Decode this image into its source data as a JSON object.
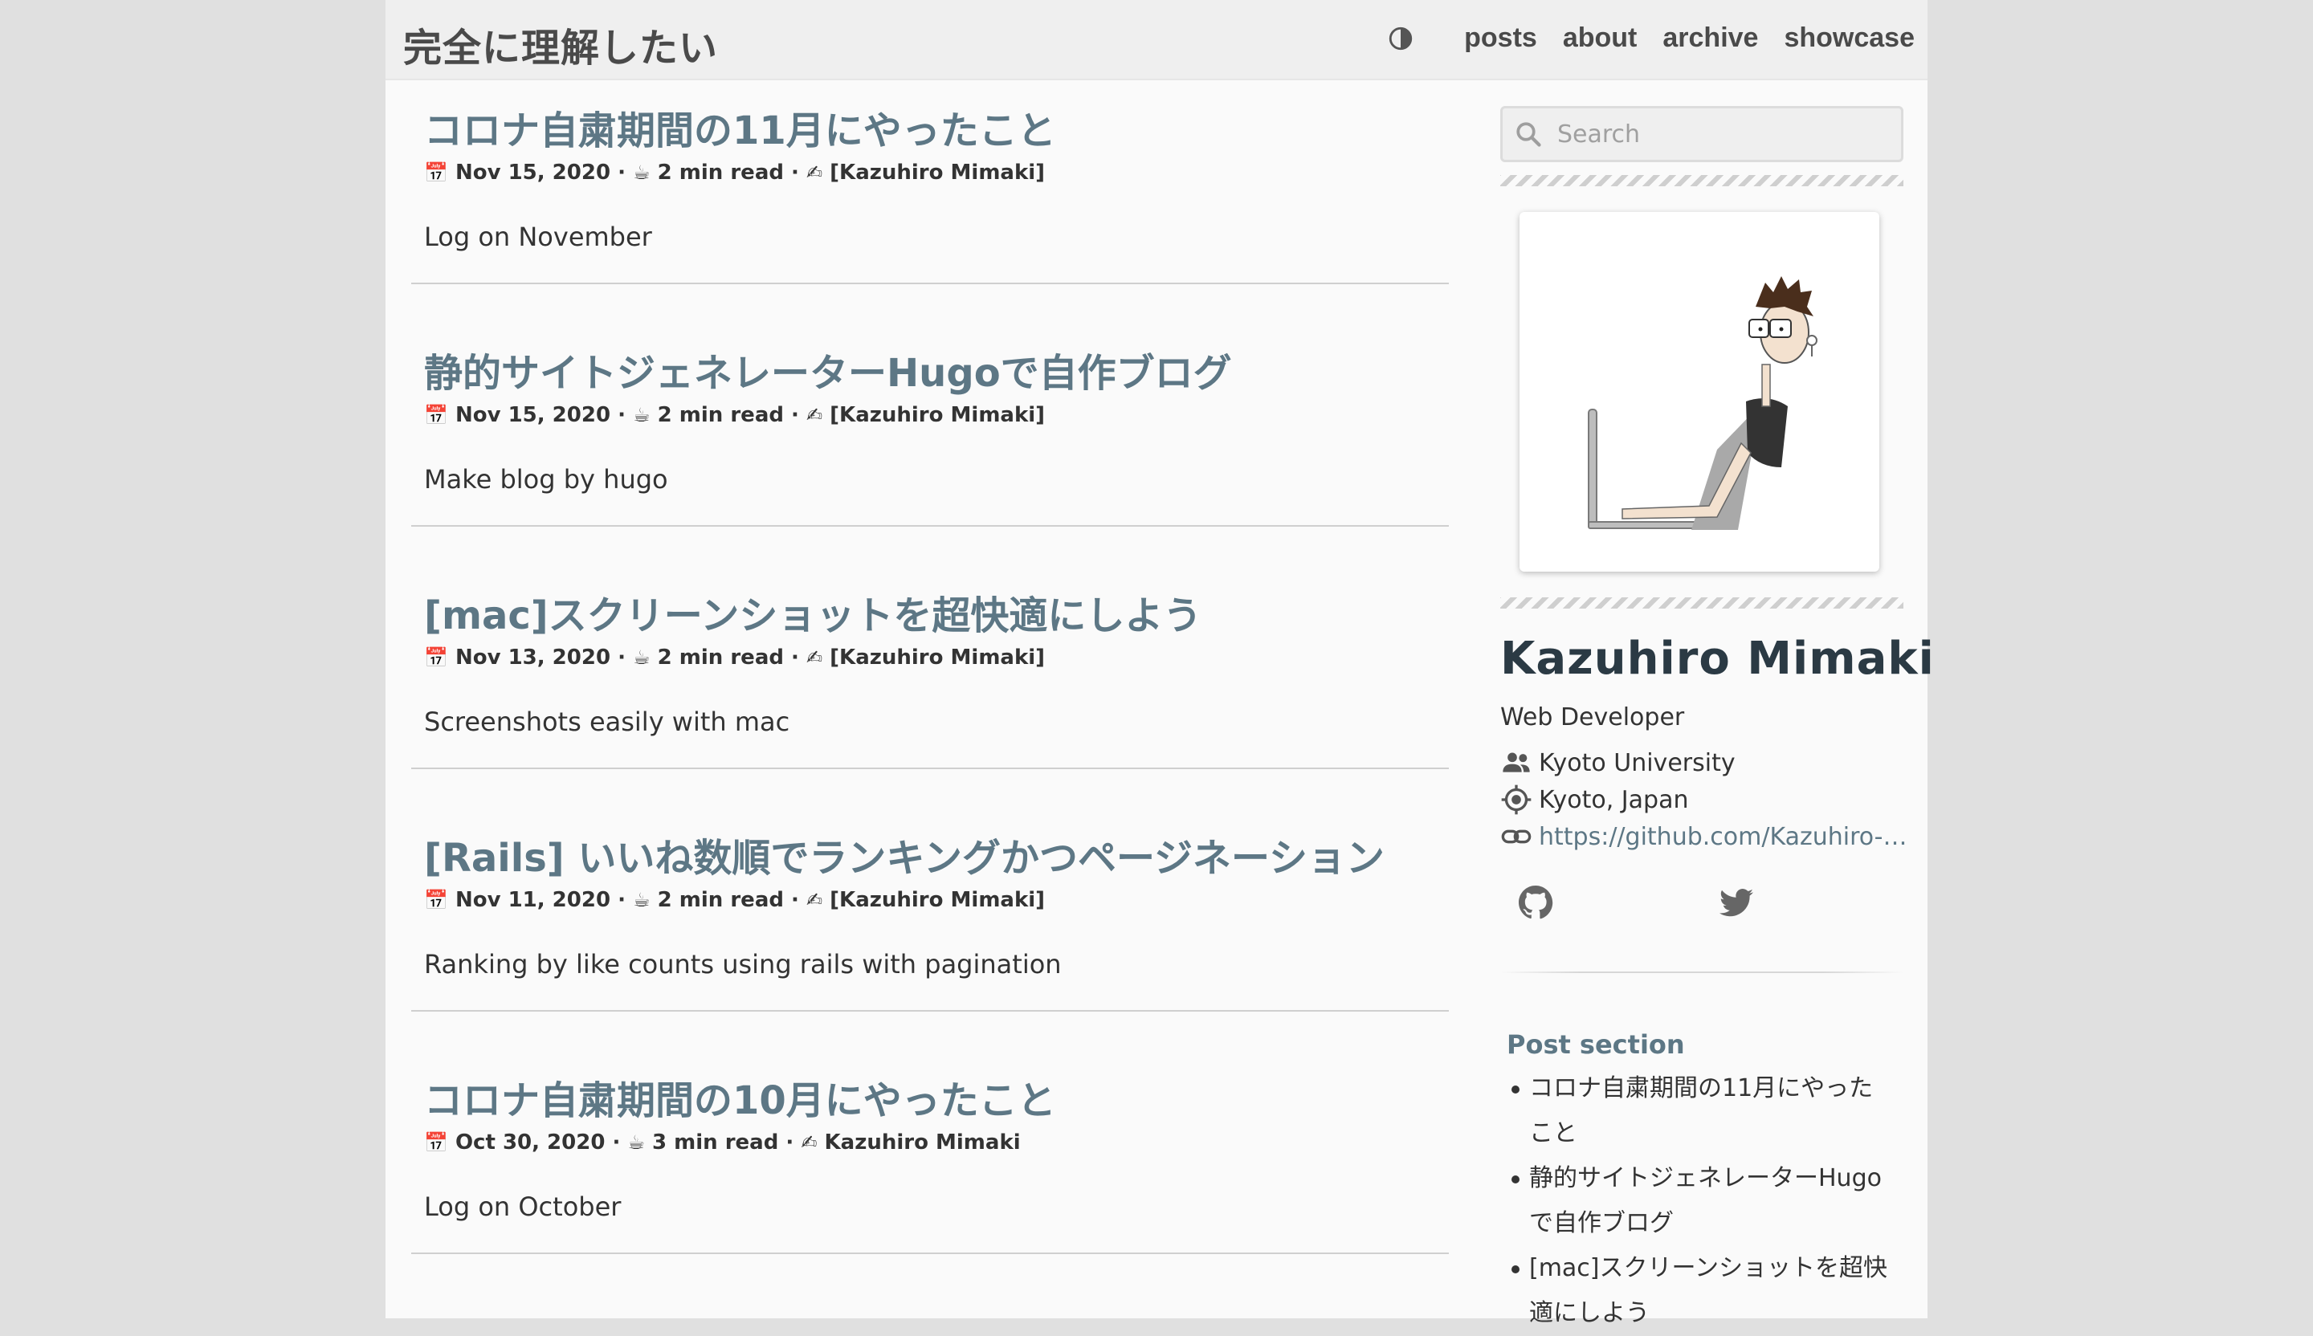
{
  "site": {
    "title": "完全に理解したい"
  },
  "nav": {
    "items": [
      "posts",
      "about",
      "archive",
      "showcase"
    ]
  },
  "posts": [
    {
      "title": "コロナ自粛期間の11月にやったこと",
      "date": "Nov 15, 2020",
      "read": "2 min read",
      "author": "[Kazuhiro Mimaki]",
      "summary": "Log on November"
    },
    {
      "title": "静的サイトジェネレーターHugoで自作ブログ",
      "date": "Nov 15, 2020",
      "read": "2 min read",
      "author": "[Kazuhiro Mimaki]",
      "summary": "Make blog by hugo"
    },
    {
      "title": "[mac]スクリーンショットを超快適にしよう",
      "date": "Nov 13, 2020",
      "read": "2 min read",
      "author": "[Kazuhiro Mimaki]",
      "summary": "Screenshots easily with mac"
    },
    {
      "title": "[Rails] いいね数順でランキングかつページネーション",
      "date": "Nov 11, 2020",
      "read": "2 min read",
      "author": "[Kazuhiro Mimaki]",
      "summary": "Ranking by like counts using rails with pagination"
    },
    {
      "title": "コロナ自粛期間の10月にやったこと",
      "date": "Oct 30, 2020",
      "read": "3 min read",
      "author": "Kazuhiro Mimaki",
      "summary": "Log on October"
    }
  ],
  "meta": {
    "date_icon": "📅",
    "read_icon": "☕",
    "author_icon": "✍",
    "separator": "·"
  },
  "sidebar": {
    "search_placeholder": "Search",
    "author_name": "Kazuhiro Mimaki",
    "role": "Web Developer",
    "organization": "Kyoto University",
    "location": "Kyoto, Japan",
    "link": "https://github.com/Kazuhiro-Mimaki",
    "section_title": "Post section",
    "section_items": [
      "コロナ自粛期間の11月にやったこと",
      "静的サイトジェネレーターHugoで自作ブログ",
      "[mac]スクリーンショットを超快適にしよう"
    ]
  },
  "colors": {
    "accent": "#5d7785",
    "page_bg": "#fafafa",
    "outer_bg": "#e0e0e0"
  }
}
